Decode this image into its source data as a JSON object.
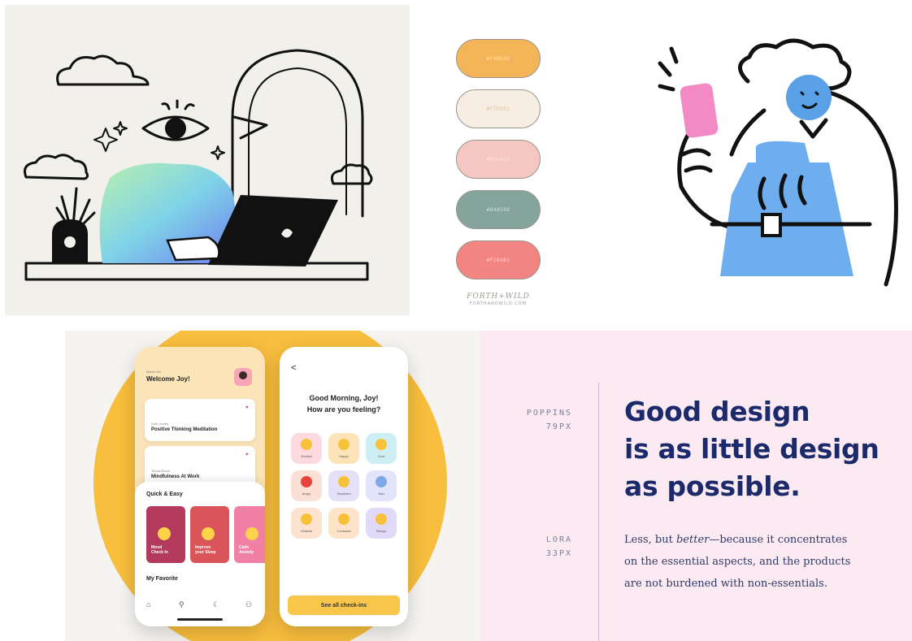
{
  "palette": {
    "swatches": [
      {
        "hex": "#F8BD4D",
        "color": "#f4b558",
        "text_color": "#f7e2b8"
      },
      {
        "hex": "#F7EDE2",
        "color": "#f7ede2",
        "text_color": "#e3c191"
      },
      {
        "hex": "#F5CAC3",
        "color": "#f5c7c2",
        "text_color": "#fbe9e6"
      },
      {
        "hex": "#84A59D",
        "color": "#84a49c",
        "text_color": "#d7e2de"
      },
      {
        "hex": "#F28482",
        "color": "#f28482",
        "text_color": "#fad6d5"
      }
    ],
    "brand_name": "FORTH+WILD",
    "brand_site": "FORTHANDWILD.COM"
  },
  "mobile": {
    "home": {
      "date": "March 4th",
      "greeting": "Welcome Joy!",
      "cards": [
        {
          "author": "Kate James",
          "title": "Positive Thinking Meditation"
        },
        {
          "author": "Tomas Brook",
          "title": "Mindfulness At Work"
        }
      ],
      "quick_title": "Quick & Easy",
      "tiles": [
        {
          "label": "Mood\nCheck In",
          "color": "#b33a5c"
        },
        {
          "label": "Improve\nyour Sleep",
          "color": "#d9555a"
        },
        {
          "label": "Calm\nAnxiety",
          "color": "#f27fa6"
        }
      ],
      "favorite_title": "My Favorite",
      "nav_icons": [
        "home-icon",
        "search-icon",
        "moon-icon",
        "profile-icon"
      ]
    },
    "checkin": {
      "back": "<",
      "title_line1": "Good Morning, Joy!",
      "title_line2": "How are you feeling?",
      "moods": [
        {
          "label": "Excited",
          "bg": "#fdd9e0"
        },
        {
          "label": "Happy",
          "bg": "#fde4b8"
        },
        {
          "label": "Cool",
          "bg": "#cdeff4"
        },
        {
          "label": "Angry",
          "bg": "#fde0d5"
        },
        {
          "label": "Surprised",
          "bg": "#e4e0f7"
        },
        {
          "label": "Sad",
          "bg": "#e1e4fb"
        },
        {
          "label": "Grateful",
          "bg": "#fde2cf"
        },
        {
          "label": "Confused",
          "bg": "#fde4c9"
        },
        {
          "label": "Sleepy",
          "bg": "#e0d9f7"
        }
      ],
      "button": "See all check-ins"
    }
  },
  "typography": {
    "heading_font": "POPPINS",
    "heading_size": "79PX",
    "headline": [
      "Good design",
      "is as little design",
      "as possible."
    ],
    "body_font": "LORA",
    "body_size": "33PX",
    "body_line1_a": "Less, but ",
    "body_line1_em": "better",
    "body_line1_b": "—because it concentrates",
    "body_line2": "on the essential aspects, and the products",
    "body_line3": "are not burdened with non-essentials."
  },
  "colors": {
    "accent_yellow": "#f7b733",
    "navy": "#1b2a6b",
    "pink_bg": "#fbeaf2"
  }
}
